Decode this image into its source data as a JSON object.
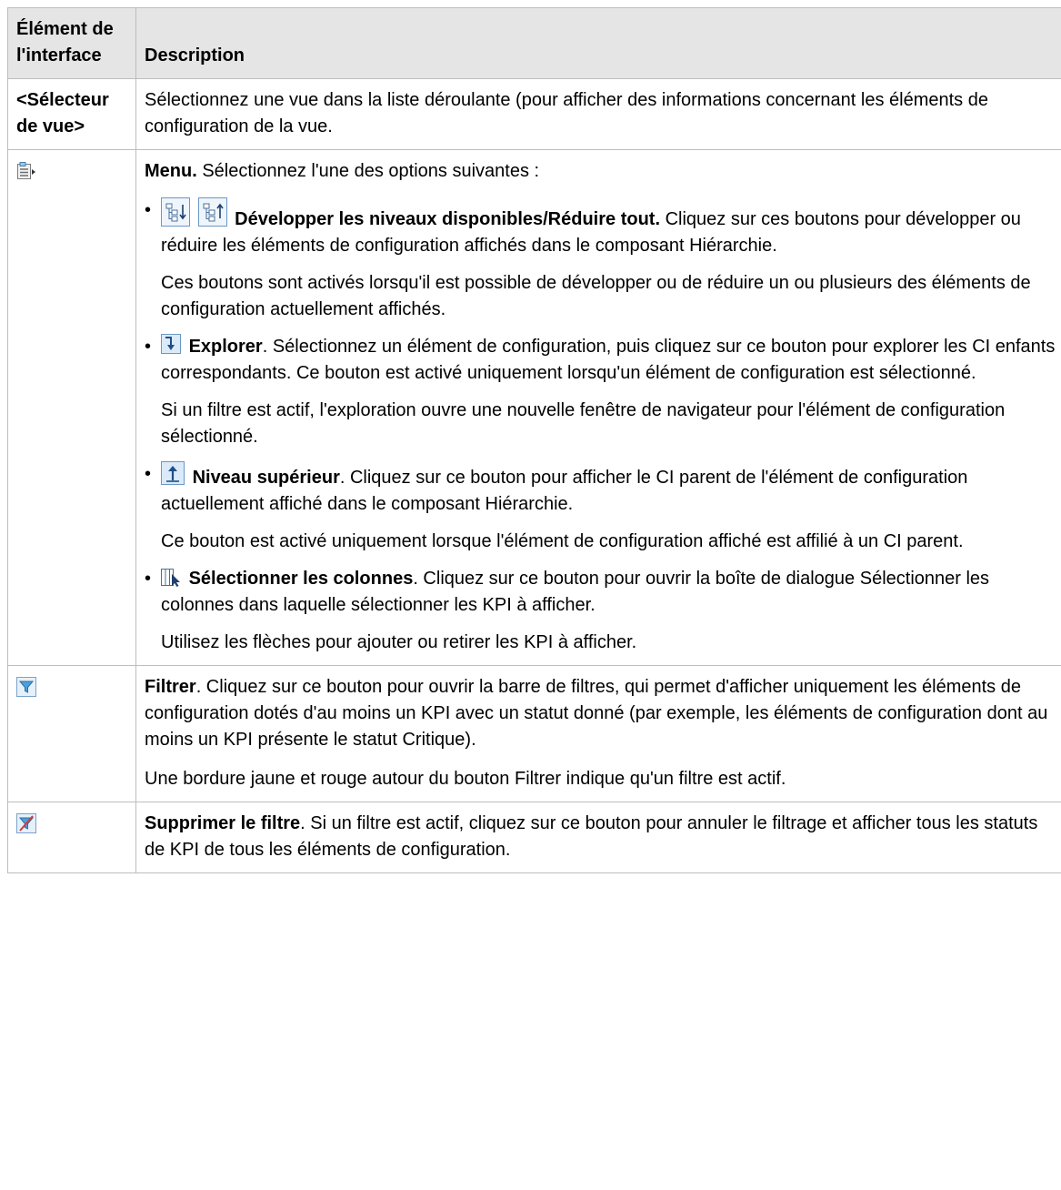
{
  "header": {
    "col1": "Élément de l'interface",
    "col2": "Description"
  },
  "rows": {
    "view_selector": {
      "label": "<Sélecteur de vue>",
      "text": "Sélectionnez une vue dans la liste déroulante (pour afficher des informations concernant les éléments de configuration de la vue."
    },
    "menu": {
      "icon": "menu-icon",
      "title": "Menu.",
      "intro": " Sélectionnez l'une des options suivantes :",
      "options": {
        "expand": {
          "icons": [
            "expand-levels-icon",
            "collapse-all-icon"
          ],
          "title": "Développer les niveaux disponibles/Réduire tout.",
          "text": " Cliquez sur ces boutons pour développer ou réduire les éléments de configuration affichés dans le composant Hiérarchie.",
          "note": "Ces boutons sont activés lorsqu'il est possible de développer ou de réduire un ou plusieurs des éléments de configuration actuellement affichés."
        },
        "explore": {
          "icon": "explore-icon",
          "title": "Explorer",
          "text": ". Sélectionnez un élément de configuration, puis cliquez sur ce bouton pour explorer les CI enfants correspondants. Ce bouton est activé uniquement lorsqu'un élément de configuration est sélectionné.",
          "note": "Si un filtre est actif, l'exploration ouvre une nouvelle fenêtre de navigateur pour l'élément de configuration sélectionné."
        },
        "level_up": {
          "icon": "level-up-icon",
          "title": "Niveau supérieur",
          "text": ". Cliquez sur ce bouton pour afficher le CI parent de l'élément de configuration actuellement affiché dans le composant Hiérarchie.",
          "note": "Ce bouton est activé uniquement lorsque l'élément de configuration affiché est affilié à un CI parent."
        },
        "columns": {
          "icon": "select-columns-icon",
          "title": "Sélectionner les colonnes",
          "text": ". Cliquez sur ce bouton pour ouvrir la boîte de dialogue Sélectionner les colonnes dans laquelle sélectionner les KPI à afficher.",
          "note": "Utilisez les flèches pour ajouter ou retirer les KPI à afficher."
        }
      }
    },
    "filter": {
      "icon": "filter-icon",
      "title": "Filtrer",
      "text": ". Cliquez sur ce bouton pour ouvrir la barre de filtres, qui permet d'afficher uniquement les éléments de configuration dotés d'au moins un KPI avec un statut donné (par exemple, les éléments de configuration dont au moins un KPI présente le statut Critique).",
      "note": "Une bordure jaune et rouge autour du bouton Filtrer indique qu'un filtre est actif."
    },
    "clear_filter": {
      "icon": "clear-filter-icon",
      "title": "Supprimer le filtre",
      "text": ". Si un filtre est actif, cliquez sur ce bouton pour annuler le filtrage et afficher tous les statuts de KPI de tous les éléments de configuration."
    }
  }
}
